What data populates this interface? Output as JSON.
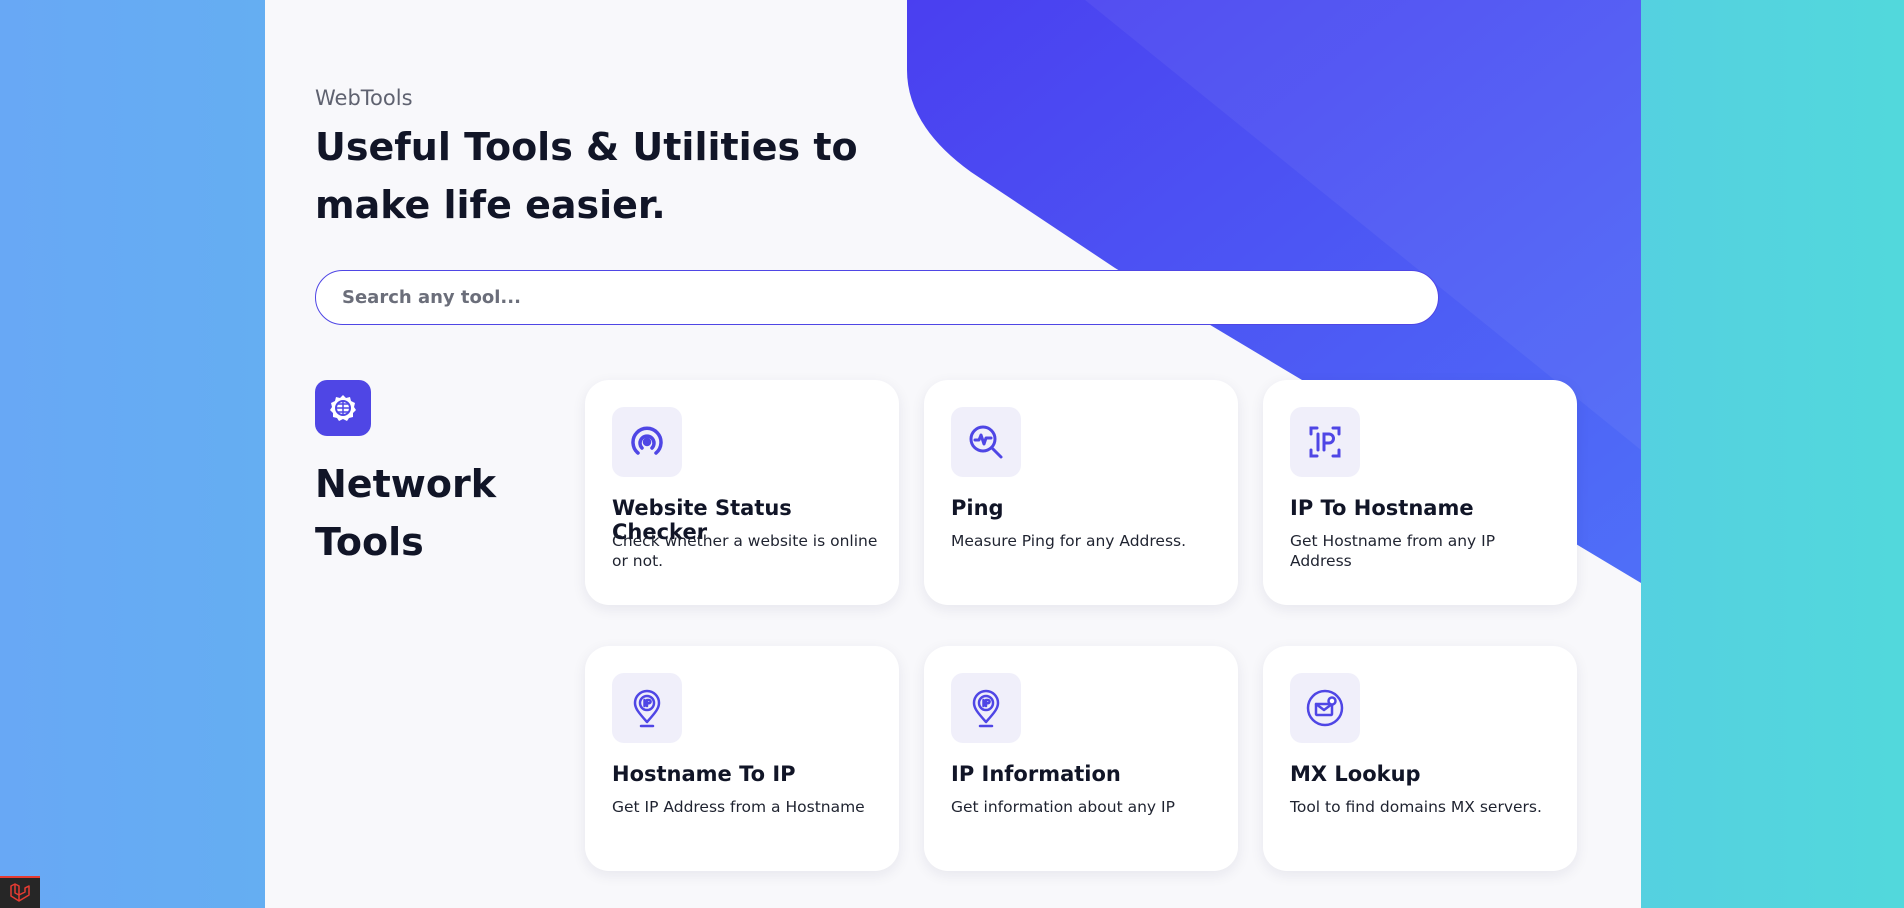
{
  "colors": {
    "accent": "#4f46e5",
    "accent_light": "#f0effa",
    "heading": "#111527",
    "page_bg": "#f8f8fb"
  },
  "header": {
    "brand": "WebTools",
    "headline": "Useful Tools & Utilities to make life easier."
  },
  "search": {
    "placeholder": "Search any tool..."
  },
  "category": {
    "title": "Network Tools",
    "icon": "globe-gear-icon"
  },
  "tools": [
    {
      "title": "Website Status Checker",
      "description": "Check whether a website is online or not.",
      "icon": "broadcast-icon"
    },
    {
      "title": "Ping",
      "description": "Measure Ping for any Address.",
      "icon": "search-pulse-icon"
    },
    {
      "title": "IP To Hostname",
      "description": "Get Hostname from any IP Address",
      "icon": "ip-scan-icon"
    },
    {
      "title": "Hostname To IP",
      "description": "Get IP Address from a Hostname",
      "icon": "ip-pin-icon"
    },
    {
      "title": "IP Information",
      "description": "Get information about any IP",
      "icon": "ip-pin-icon"
    },
    {
      "title": "MX Lookup",
      "description": "Tool to find domains MX servers.",
      "icon": "mail-globe-icon"
    }
  ],
  "footer": {
    "corner_icon": "laravel-logo-icon"
  }
}
